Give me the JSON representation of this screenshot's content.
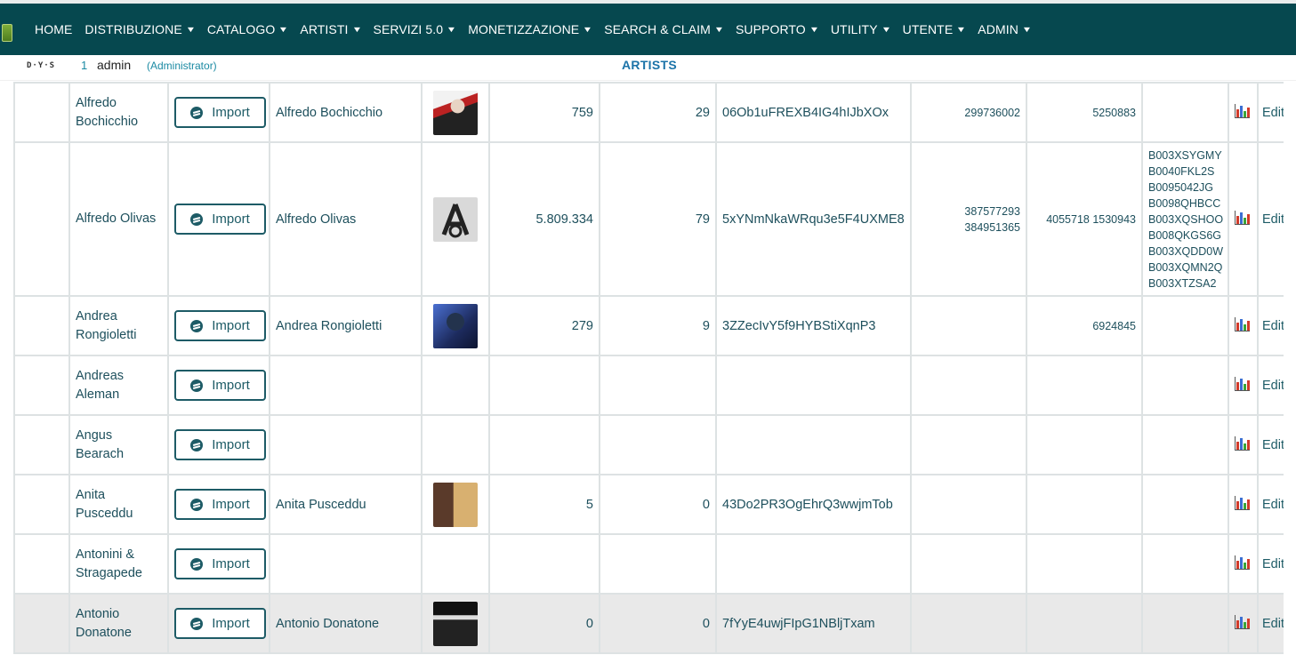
{
  "nav": {
    "items": [
      {
        "label": "HOME",
        "has_caret": false
      },
      {
        "label": "DISTRIBUZIONE",
        "has_caret": true
      },
      {
        "label": "CATALOGO",
        "has_caret": true
      },
      {
        "label": "ARTISTI",
        "has_caret": true
      },
      {
        "label": "SERVIZI 5.0",
        "has_caret": true
      },
      {
        "label": "MONETIZZAZIONE",
        "has_caret": true
      },
      {
        "label": "SEARCH & CLAIM",
        "has_caret": true
      },
      {
        "label": "SUPPORTO",
        "has_caret": true
      },
      {
        "label": "UTILITY",
        "has_caret": true
      },
      {
        "label": "UTENTE",
        "has_caret": true
      },
      {
        "label": "ADMIN",
        "has_caret": true
      }
    ],
    "caret_icon": "chevron-down-icon"
  },
  "user": {
    "brand_mini": "D·Y·S",
    "count": "1",
    "name": "admin",
    "role": "(Administrator)"
  },
  "page": {
    "title": "ARTISTS"
  },
  "table": {
    "import_label": "Import",
    "edit_label": "Edit",
    "rows": [
      {
        "name": "Alfredo Bochicchio",
        "spotify_name": "Alfredo Bochicchio",
        "thumb": "photo",
        "followers": "759",
        "popularity": "29",
        "spotify_id": "06Ob1uFREXB4IG4hIJbXOx",
        "col_a": "299736002",
        "col_b": "5250883",
        "asins": [],
        "highlight": false
      },
      {
        "name": "Alfredo Olivas",
        "spotify_name": "Alfredo Olivas",
        "thumb": "logo",
        "followers": "5.809.334",
        "popularity": "79",
        "spotify_id": "5xYNmNkaWRqu3e5F4UXME8",
        "col_a": "387577293 384951365",
        "col_b": "4055718 1530943",
        "asins": [
          "B003XSYGMY",
          "B0040FKL2S",
          "B0095042JG",
          "B0098QHBCC",
          "B003XQSHOO",
          "B008QKGS6G",
          "B003XQDD0W",
          "B003XQMN2Q",
          "B003XTZSA2"
        ],
        "highlight": false
      },
      {
        "name": "Andrea Rongioletti",
        "spotify_name": "Andrea Rongioletti",
        "thumb": "photo-blue",
        "followers": "279",
        "popularity": "9",
        "spotify_id": "3ZZecIvY5f9HYBStiXqnP3",
        "col_a": "",
        "col_b": "6924845",
        "asins": [],
        "highlight": false
      },
      {
        "name": "Andreas Aleman",
        "spotify_name": "",
        "thumb": "",
        "followers": "",
        "popularity": "",
        "spotify_id": "",
        "col_a": "",
        "col_b": "",
        "asins": [],
        "highlight": false
      },
      {
        "name": "Angus Bearach",
        "spotify_name": "",
        "thumb": "",
        "followers": "",
        "popularity": "",
        "spotify_id": "",
        "col_a": "",
        "col_b": "",
        "asins": [],
        "highlight": false
      },
      {
        "name": "Anita Pusceddu",
        "spotify_name": "Anita Pusceddu",
        "thumb": "photo-warm",
        "followers": "5",
        "popularity": "0",
        "spotify_id": "43Do2PR3OgEhrQ3wwjmTob",
        "col_a": "",
        "col_b": "",
        "asins": [],
        "highlight": false
      },
      {
        "name": "Antonini & Stragapede",
        "spotify_name": "",
        "thumb": "",
        "followers": "",
        "popularity": "",
        "spotify_id": "",
        "col_a": "",
        "col_b": "",
        "asins": [],
        "highlight": false
      },
      {
        "name": "Antonio Donatone",
        "spotify_name": "Antonio Donatone",
        "thumb": "photo-dark",
        "followers": "0",
        "popularity": "0",
        "spotify_id": "7fYyE4uwjFIpG1NBljTxam",
        "col_a": "",
        "col_b": "",
        "asins": [],
        "highlight": true
      }
    ]
  },
  "colors": {
    "navbar": "#06484f",
    "text": "#1d4f5c",
    "accent": "#1b73a8",
    "row_highlight": "#e9e9e9"
  }
}
